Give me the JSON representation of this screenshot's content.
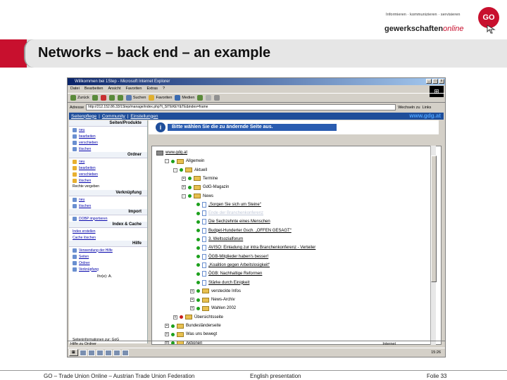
{
  "brand": {
    "tagline": "Informieren · kommunizieren · servisieren",
    "name_main": "gewerkschaften",
    "name_suffix": "online",
    "logo_text": "GO",
    "accent_color": "#c8102e"
  },
  "slide": {
    "title": "Networks – back end – an example"
  },
  "browser": {
    "window_title": "Willkommen bei 1Step - Microsoft Internet Explorer",
    "menu": [
      "Datei",
      "Bearbeiten",
      "Ansicht",
      "Favoriten",
      "Extras",
      "?"
    ],
    "toolbar": [
      "Zurück",
      "Suchen",
      "Favoriten",
      "Medien"
    ],
    "address_label": "Adresse",
    "address_value": "http://212.152.86.33/1Step/manage/index.php?t_SITEKEY&TE&index=frame",
    "go_label": "Wechseln zu",
    "links_label": "Links",
    "status_text": "Hilfe zu Ordner",
    "zone_text": "Internet",
    "clock": "15:26"
  },
  "site": {
    "nav": [
      "Seitenpflege",
      "Community",
      "Einstellungen"
    ],
    "url": "www.gdg.at",
    "banner": "Bitte wählen Sie die zu ändernde Seite aus.",
    "panel": {
      "sections": [
        {
          "title": "Seiten/Produkte",
          "items": [
            "neu",
            "bearbeiten",
            "verschieben",
            "löschen"
          ]
        },
        {
          "title": "Ordner",
          "items": [
            "neu",
            "bearbeiten",
            "verschieben",
            "löschen"
          ],
          "note": "Rechte vergeben"
        },
        {
          "title": "Verknüpfung",
          "items": [
            "neu",
            "löschen"
          ]
        },
        {
          "title": "Import",
          "items": [
            "DOBP importieren"
          ]
        },
        {
          "title": "Index & Cache",
          "items": [
            "Index erstellen",
            "Cache löschen"
          ]
        },
        {
          "title": "Hilfe",
          "items": [
            "Verwendung der Hilfe",
            "Seiten",
            "Ordner",
            "Verknüpfung"
          ]
        }
      ],
      "user": "Ihr(e): A.",
      "footer": "Seiteninformationen zur: GoG"
    },
    "tree": [
      {
        "label": "www.gdg.at",
        "level": 0,
        "kind": "root",
        "link": true
      },
      {
        "label": "Allgemein",
        "level": 1,
        "kind": "folder",
        "toggle": "-"
      },
      {
        "label": "Aktuell",
        "level": 2,
        "kind": "folder",
        "toggle": "-"
      },
      {
        "label": "Termine",
        "level": 3,
        "kind": "folder",
        "toggle": "+"
      },
      {
        "label": "GdG-Magazin",
        "level": 3,
        "kind": "folder",
        "toggle": "+"
      },
      {
        "label": "News",
        "level": 3,
        "kind": "folder",
        "toggle": "-"
      },
      {
        "label": "„Sorgen Sie sich um Steine“",
        "level": 4,
        "kind": "page",
        "link": true
      },
      {
        "label": "Ende der Branchenkonferenz",
        "level": 4,
        "kind": "page",
        "link": true,
        "selected": true
      },
      {
        "label": "Die Sechzehnte eines Menschen",
        "level": 4,
        "kind": "page",
        "link": true
      },
      {
        "label": "Budget-Hunderter Gsch. „OFFEN GESAGT“",
        "level": 4,
        "kind": "page",
        "link": true
      },
      {
        "label": "3. Weltsozialforum",
        "level": 4,
        "kind": "page",
        "link": true
      },
      {
        "label": "AVISO: Einladung zur intra Branchenkonferenz - Verteiler",
        "level": 4,
        "kind": "page",
        "link": true
      },
      {
        "label": "ÖGB-Mitglieder haben's besser!",
        "level": 4,
        "kind": "page",
        "link": true
      },
      {
        "label": "„Koalition gegen Arbeitslosigkeit“",
        "level": 4,
        "kind": "page",
        "link": true
      },
      {
        "label": "ÖGB: Nachhaltige Reformen",
        "level": 4,
        "kind": "page",
        "link": true
      },
      {
        "label": "Stärke durch Einigkeit",
        "level": 4,
        "kind": "page",
        "link": true
      },
      {
        "label": "versteckte Infos",
        "level": 4,
        "kind": "folder",
        "toggle": "+"
      },
      {
        "label": "News-Archiv",
        "level": 4,
        "kind": "folder",
        "toggle": "+"
      },
      {
        "label": "Wahlen 2002",
        "level": 4,
        "kind": "folder",
        "toggle": "+"
      },
      {
        "label": "Übersichtsseite",
        "level": 2,
        "kind": "folder",
        "toggle": "+",
        "status": "red"
      },
      {
        "label": "Bundesländerseite",
        "level": 1,
        "kind": "folder",
        "toggle": "+"
      },
      {
        "label": "Was uns bewegt",
        "level": 1,
        "kind": "folder",
        "toggle": "+"
      },
      {
        "label": "Aktionen",
        "level": 1,
        "kind": "folder",
        "toggle": "+"
      }
    ]
  },
  "footer": {
    "left": "GO – Trade Union Online – Austrian Trade Union Federation",
    "center": "English presentation",
    "right": "Folie 33"
  }
}
